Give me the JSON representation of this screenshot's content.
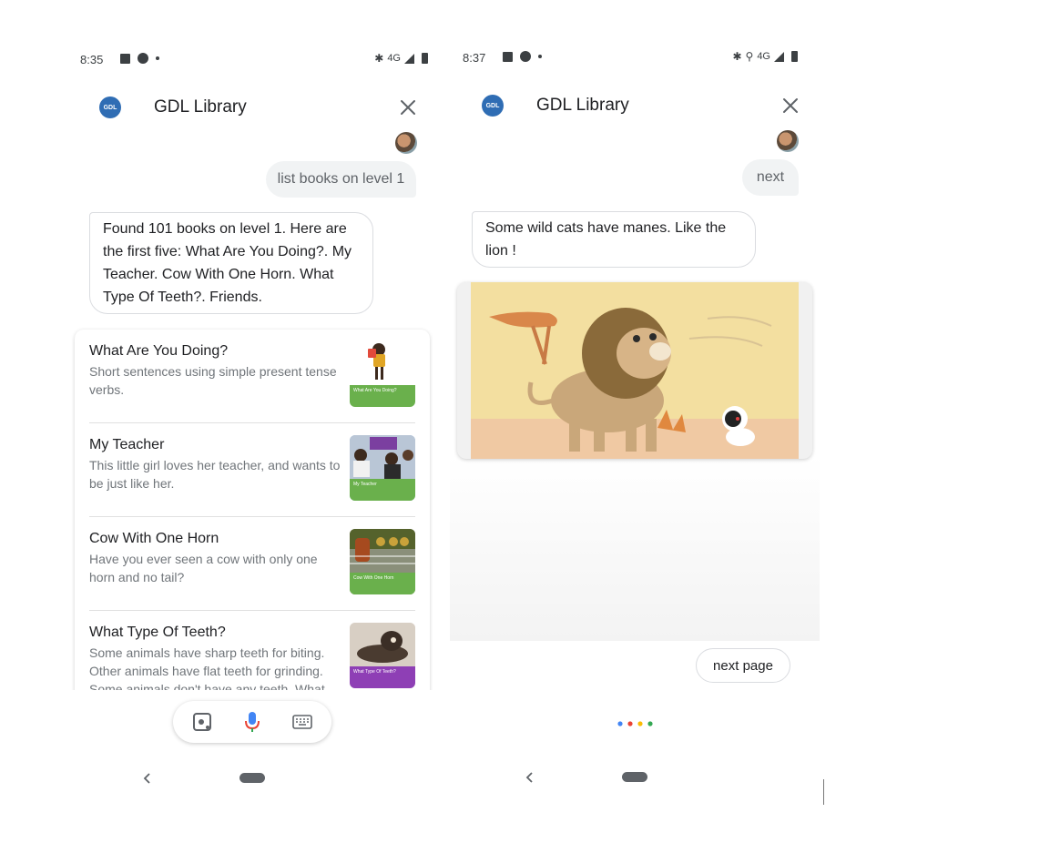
{
  "left_screen": {
    "status": {
      "time": "8:35",
      "network": "4G"
    },
    "app": {
      "logo_text": "GDL",
      "title": "GDL Library"
    },
    "user_message": "list books on level 1",
    "bot_message": "Found 101 books on level 1. Here are the first five: What Are You Doing?. My Teacher. Cow With One Horn. What Type Of Teeth?. Friends.",
    "books": [
      {
        "title": "What Are You Doing?",
        "description": "Short sentences using simple present tense verbs.",
        "thumb_label": "What Are You Doing?",
        "thumb_color": "#6ab04c"
      },
      {
        "title": "My Teacher",
        "description": "This little girl loves her teacher, and wants to be just like her.",
        "thumb_label": "My Teacher",
        "thumb_color": "#6ab04c"
      },
      {
        "title": "Cow With One Horn",
        "description": "Have you ever seen a cow with only one horn and no tail?",
        "thumb_label": "Cow With One Horn",
        "thumb_color": "#6ab04c"
      },
      {
        "title": "What Type Of Teeth?",
        "description": "Some animals have sharp teeth for biting. Other animals have flat teeth for grinding. Some animals don't have any teeth. What",
        "thumb_label": "What Type Of Teeth?",
        "thumb_color": "#8e3fb5"
      }
    ]
  },
  "right_screen": {
    "status": {
      "time": "8:37",
      "network": "4G"
    },
    "app": {
      "logo_text": "GDL",
      "title": "GDL Library"
    },
    "user_message": "next",
    "bot_message": "Some wild cats have manes. Like the lion !",
    "suggestion_chip": "next page"
  },
  "colors": {
    "logo_blue": "#2f6db4",
    "assistant_dots": [
      "#4285f4",
      "#ea4335",
      "#fbbc05",
      "#34a853"
    ]
  }
}
